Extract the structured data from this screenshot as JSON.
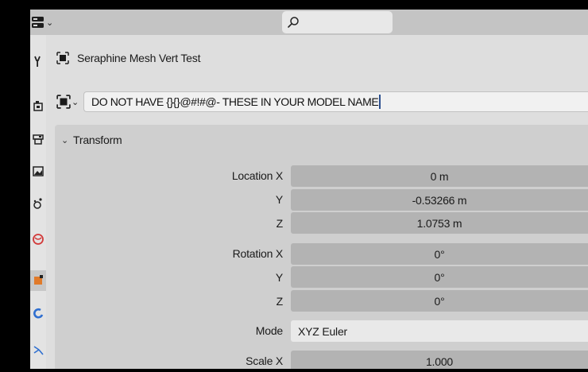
{
  "header": {
    "search_icon": "magnifier-icon",
    "editor_icon": "properties-editor-icon"
  },
  "tabs": [
    {
      "name": "tool-tab",
      "icon": "wrench-icon"
    },
    {
      "name": "render-tab",
      "icon": "camera-back-icon"
    },
    {
      "name": "output-tab",
      "icon": "printer-icon"
    },
    {
      "name": "view-layer-tab",
      "icon": "image-icon"
    },
    {
      "name": "scene-tab",
      "icon": "scene-icon"
    },
    {
      "name": "world-tab",
      "icon": "world-icon"
    },
    {
      "name": "object-tab",
      "icon": "object-icon",
      "active": true
    },
    {
      "name": "modifiers-tab",
      "icon": "wrench-blue-icon"
    },
    {
      "name": "particles-tab",
      "icon": "particles-icon"
    }
  ],
  "context": {
    "object_name": "Seraphine Mesh Vert Test"
  },
  "object": {
    "name_value": "DO NOT HAVE {}{}@#!#@- THESE IN YOUR MODEL NAME"
  },
  "transform": {
    "title": "Transform",
    "location": {
      "label_x": "Location X",
      "label_y": "Y",
      "label_z": "Z",
      "x": "0 m",
      "y": "-0.53266 m",
      "z": "1.0753 m"
    },
    "rotation": {
      "label_x": "Rotation X",
      "label_y": "Y",
      "label_z": "Z",
      "x": "0°",
      "y": "0°",
      "z": "0°"
    },
    "mode": {
      "label": "Mode",
      "value": "XYZ Euler"
    },
    "scale": {
      "label_x": "Scale X",
      "x": "1.000"
    }
  },
  "colors": {
    "accent_object_tab": "#e07a2a",
    "modifier_blue": "#2f6fd0",
    "world_red": "#d23a3a",
    "text_caret": "#2b4f8f"
  }
}
